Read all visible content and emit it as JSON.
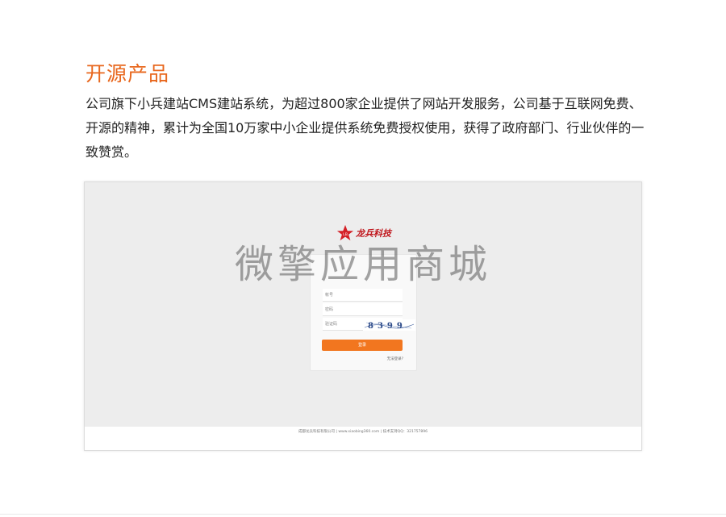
{
  "section": {
    "title": "开源产品",
    "description": "公司旗下小兵建站CMS建站系统，为超过800家企业提供了网站开发服务，公司基于互联网免费、开源的精神，累计为全国10万家中小企业提供系统免费授权使用，获得了政府部门、行业伙伴的一致赞赏。"
  },
  "preview": {
    "watermark": "微擎应用商城",
    "brand_icon": "red-star-logo-icon",
    "brand_name": "龙兵科技",
    "login": {
      "account_placeholder": "帐号",
      "password_placeholder": "密码",
      "captcha_placeholder": "验证码",
      "captcha_text": "8399",
      "submit_label": "登录",
      "forgot_label": "无法登录?"
    },
    "footer": "成都龙兵科技有限公司  |  www.xiaobing360.com  |  技术支持QQ：321757896"
  },
  "colors": {
    "accent": "#e8671d",
    "button": "#f2761f",
    "brand_red": "#c0171d",
    "preview_bg": "#ededed"
  }
}
